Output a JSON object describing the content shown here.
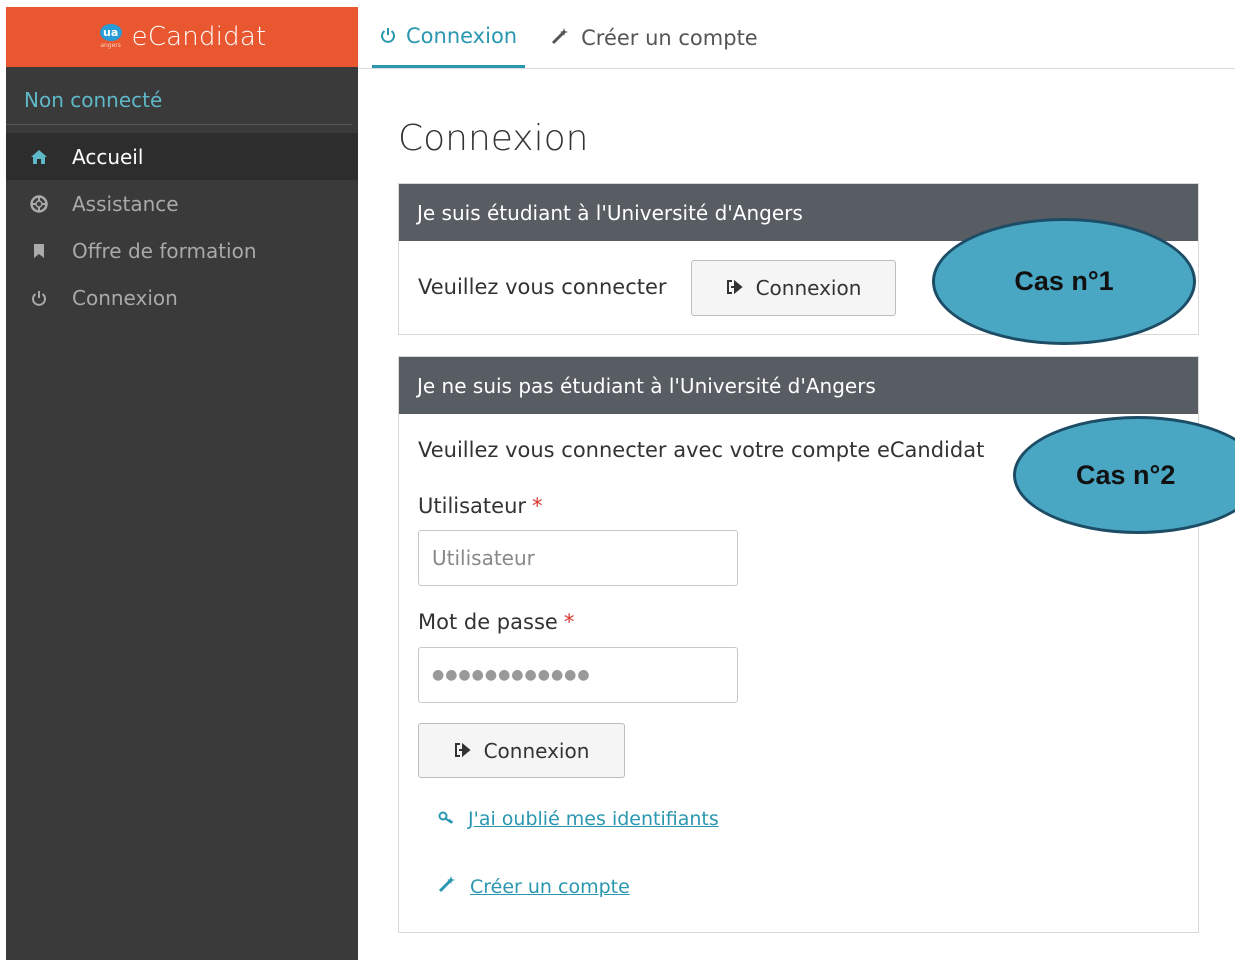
{
  "brand": {
    "logo_text": "ua",
    "logo_sub": "angers",
    "name": "eCandidat"
  },
  "sidebar": {
    "status": "Non connecté",
    "items": [
      {
        "label": "Accueil",
        "icon": "home-icon",
        "active": true
      },
      {
        "label": "Assistance",
        "icon": "lifebuoy-icon",
        "active": false
      },
      {
        "label": "Offre de formation",
        "icon": "bookmark-icon",
        "active": false
      },
      {
        "label": "Connexion",
        "icon": "power-icon",
        "active": false
      }
    ]
  },
  "topbar": {
    "tabs": [
      {
        "label": "Connexion",
        "icon": "power-icon",
        "active": true
      },
      {
        "label": "Créer un compte",
        "icon": "magic-wand-icon",
        "active": false
      }
    ]
  },
  "main": {
    "title": "Connexion",
    "panel_student": {
      "header": "Je suis étudiant à l'Université d'Angers",
      "prompt": "Veuillez vous connecter",
      "button": "Connexion"
    },
    "panel_other": {
      "header": "Je ne suis pas étudiant à l'Université d'Angers",
      "prompt": "Veuillez vous connecter avec votre compte eCandidat",
      "user_label": "Utilisateur",
      "user_placeholder": "Utilisateur",
      "password_label": "Mot de passe",
      "password_value": "●●●●●●●●●●●●",
      "required_mark": "*",
      "button": "Connexion",
      "forgot_link": "J'ai oublié mes identifiants",
      "create_link": "Créer un compte"
    }
  },
  "annotations": [
    {
      "label": "Cas n°1"
    },
    {
      "label": "Cas n°2"
    }
  ],
  "colors": {
    "brand": "#e8572f",
    "sidebar": "#3a3a3a",
    "accent": "#2a97b0",
    "panel_header": "#585c63",
    "annotation_fill": "#4aa7c3"
  }
}
